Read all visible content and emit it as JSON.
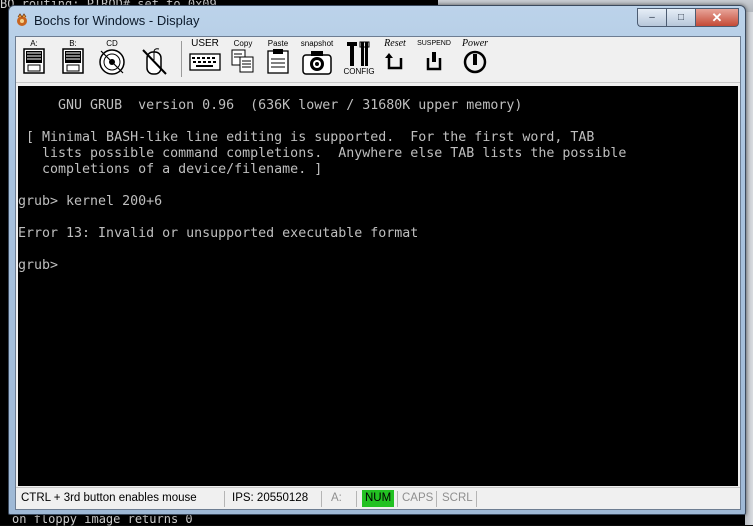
{
  "background_console": {
    "top_line": "BQ routing: PIRQD# set to 0x09",
    "bottom_line": "on floppy image returns 0"
  },
  "window": {
    "title": "Bochs for Windows - Display",
    "icon": "bochs-app-icon",
    "controls": {
      "minimize": "–",
      "maximize": "□",
      "close": "✕"
    }
  },
  "toolbar": {
    "floppy_a": "A:",
    "floppy_b": "B:",
    "cdrom": "CD",
    "mouse": "",
    "user": "USER",
    "copy": "Copy",
    "paste": "Paste",
    "snapshot": "snapshot",
    "config": "CONFIG",
    "reset": "Reset",
    "suspend": "SUSPEND",
    "power": "Power"
  },
  "terminal": {
    "lines": [
      "     GNU GRUB  version 0.96  (636K lower / 31680K upper memory)",
      "",
      " [ Minimal BASH-like line editing is supported.  For the first word, TAB",
      "   lists possible command completions.  Anywhere else TAB lists the possible",
      "   completions of a device/filename. ]",
      "",
      "grub> kernel 200+6",
      "",
      "Error 13: Invalid or unsupported executable format",
      "",
      "grub> "
    ],
    "foreground": "#bfbfbf",
    "background": "#000000"
  },
  "statusbar": {
    "mouse_hint": "CTRL + 3rd button enables mouse",
    "ips": "IPS: 20550128",
    "drive": "A:",
    "num": "NUM",
    "caps": "CAPS",
    "scrl": "SCRL",
    "num_active_color": "#22c122"
  }
}
